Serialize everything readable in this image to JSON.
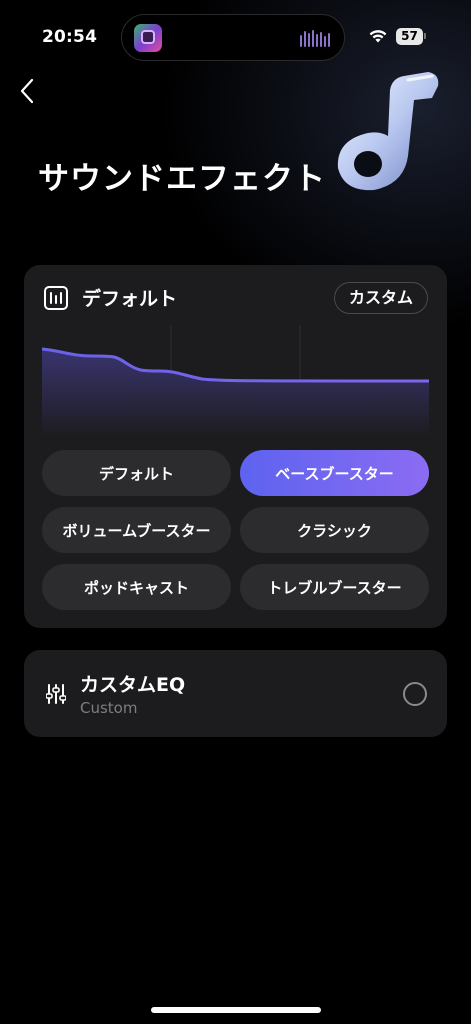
{
  "status": {
    "time": "20:54",
    "battery": "57"
  },
  "page": {
    "title": "サウンドエフェクト"
  },
  "preset_card": {
    "selected_title": "デフォルト",
    "custom_button": "カスタム",
    "presets": [
      {
        "label": "デフォルト",
        "active": false
      },
      {
        "label": "ベースブースター",
        "active": true
      },
      {
        "label": "ボリュームブースター",
        "active": false
      },
      {
        "label": "クラシック",
        "active": false
      },
      {
        "label": "ポッドキャスト",
        "active": false
      },
      {
        "label": "トレブルブースター",
        "active": false
      }
    ]
  },
  "custom_eq": {
    "title": "カスタムEQ",
    "subtitle": "Custom"
  },
  "colors": {
    "accent": "#6f6af2",
    "card": "#1c1c1e",
    "button": "#2c2c2e",
    "muted": "#7d7d82"
  }
}
